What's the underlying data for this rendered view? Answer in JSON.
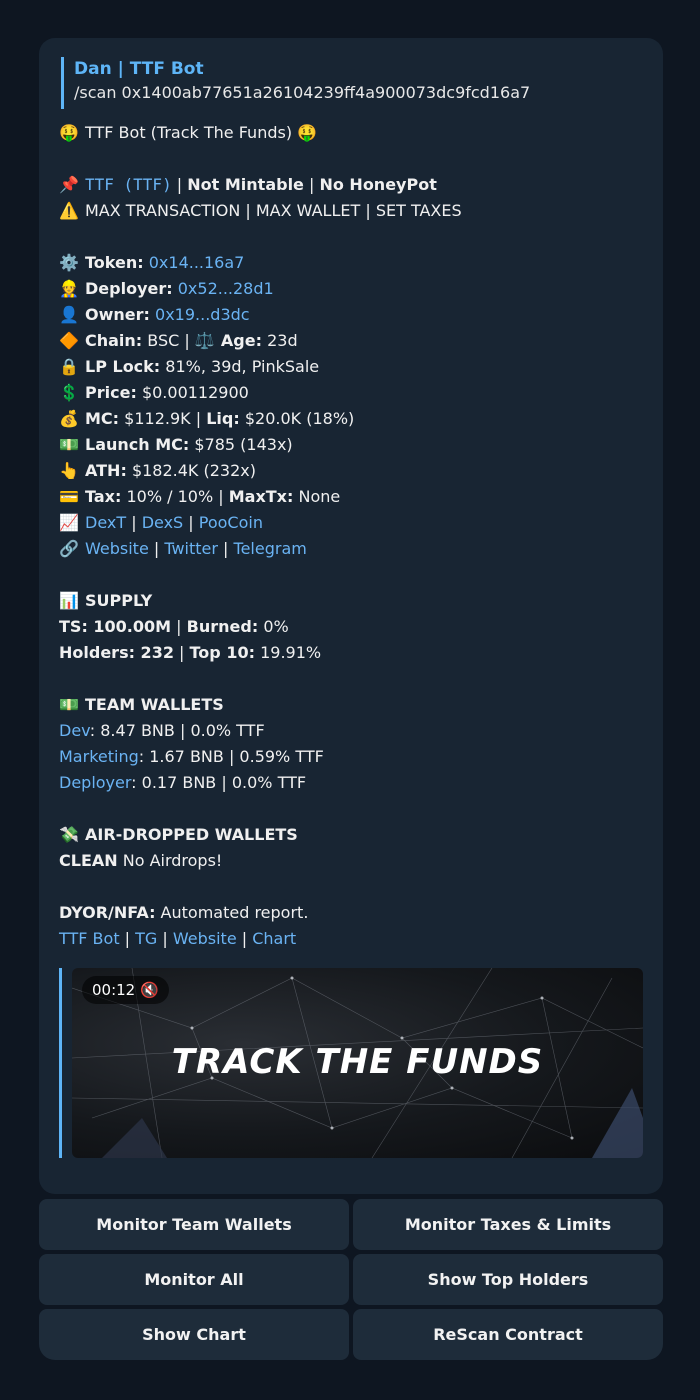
{
  "reply": {
    "name": "Dan | TTF Bot",
    "text": "/scan 0x1400ab77651a26104239ff4a900073dc9fcd16a7"
  },
  "message": {
    "header": {
      "emoji_left": "🤑",
      "title": "TTF Bot (Track The Funds)",
      "emoji_right": "🤑"
    },
    "token_line": {
      "emoji": "📌",
      "name": "TTF (TTF)",
      "sep1": " | ",
      "mintable": "Not Mintable",
      "sep2": " | ",
      "honeypot": "No HoneyPot"
    },
    "warning_line": {
      "emoji": "⚠️",
      "text": "MAX TRANSACTION | MAX WALLET | SET TAXES"
    },
    "token": {
      "emoji": "⚙️",
      "label": "Token:",
      "value": "0x14...16a7"
    },
    "deployer": {
      "emoji": "👷",
      "label": "Deployer:",
      "value": "0x52...28d1"
    },
    "owner": {
      "emoji": "👤",
      "label": "Owner:",
      "value": "0x19...d3dc"
    },
    "chain": {
      "emoji": "🔶",
      "label": "Chain:",
      "value": "BSC",
      "sep": " | ",
      "emoji2": "⚖️",
      "age_label": "Age:",
      "age_value": "23d"
    },
    "lp_lock": {
      "emoji": "🔒",
      "label": "LP Lock:",
      "value": "81%, 39d, PinkSale"
    },
    "price": {
      "emoji": "💲",
      "label": "Price:",
      "value": "$0.00112900"
    },
    "mc": {
      "emoji": "💰",
      "label": "MC:",
      "value": "$112.9K",
      "sep": " | ",
      "liq_label": "Liq:",
      "liq_value": "$20.0K (18%)"
    },
    "launch_mc": {
      "emoji": "💵",
      "label": "Launch MC:",
      "value": "$785 (143x)"
    },
    "ath": {
      "emoji": "👆",
      "label": "ATH:",
      "value": "$182.4K (232x)"
    },
    "tax": {
      "emoji": "💳",
      "label": "Tax:",
      "value": "10% / 10%",
      "sep": " | ",
      "maxtx_label": "MaxTx:",
      "maxtx_value": "None"
    },
    "charts": {
      "emoji": "📈",
      "l1": "DexT",
      "sep1": " | ",
      "l2": "DexS",
      "sep2": " | ",
      "l3": "PooCoin"
    },
    "socials": {
      "emoji": "🔗",
      "l1": "Website",
      "sep1": " | ",
      "l2": "Twitter",
      "sep2": " | ",
      "l3": "Telegram"
    },
    "supply": {
      "emoji": "📊",
      "title": "SUPPLY",
      "ts_label": "TS: 100.00M",
      "sep1": " | ",
      "burned_label": "Burned:",
      "burned_value": "0%",
      "holders_label": "Holders: 232",
      "sep2": " | ",
      "top10_label": "Top 10:",
      "top10_value": "19.91%"
    },
    "team": {
      "emoji": "💵",
      "title": "TEAM WALLETS",
      "dev_label": "Dev",
      "dev_value": ": 8.47 BNB | 0.0% TTF",
      "mkt_label": "Marketing",
      "mkt_value": ": 1.67 BNB | 0.59% TTF",
      "dep_label": "Deployer",
      "dep_value": ": 0.17 BNB | 0.0% TTF"
    },
    "airdrop": {
      "emoji": "💸",
      "title": "AIR-DROPPED WALLETS",
      "clean": "CLEAN",
      "text": " No Airdrops!"
    },
    "dyor": {
      "label": "DYOR/NFA:",
      "text": " Automated report."
    },
    "footer_links": {
      "l1": "TTF Bot",
      "sep1": " | ",
      "l2": "TG",
      "sep2": " | ",
      "l3": "Website",
      "sep3": " | ",
      "l4": "Chart"
    },
    "video": {
      "time": "00:12",
      "mute_icon": "🔇",
      "title": "TRACK THE FUNDS"
    }
  },
  "keyboard": {
    "rows": [
      [
        "Monitor Team Wallets",
        "Monitor Taxes & Limits"
      ],
      [
        "Monitor All",
        "Show Top Holders"
      ],
      [
        "Show Chart",
        "ReScan Contract"
      ]
    ]
  },
  "colors": {
    "link": "#6ab3f3",
    "bubble": "#182533",
    "background": "#0e1621",
    "button": "#1e2c3a"
  }
}
